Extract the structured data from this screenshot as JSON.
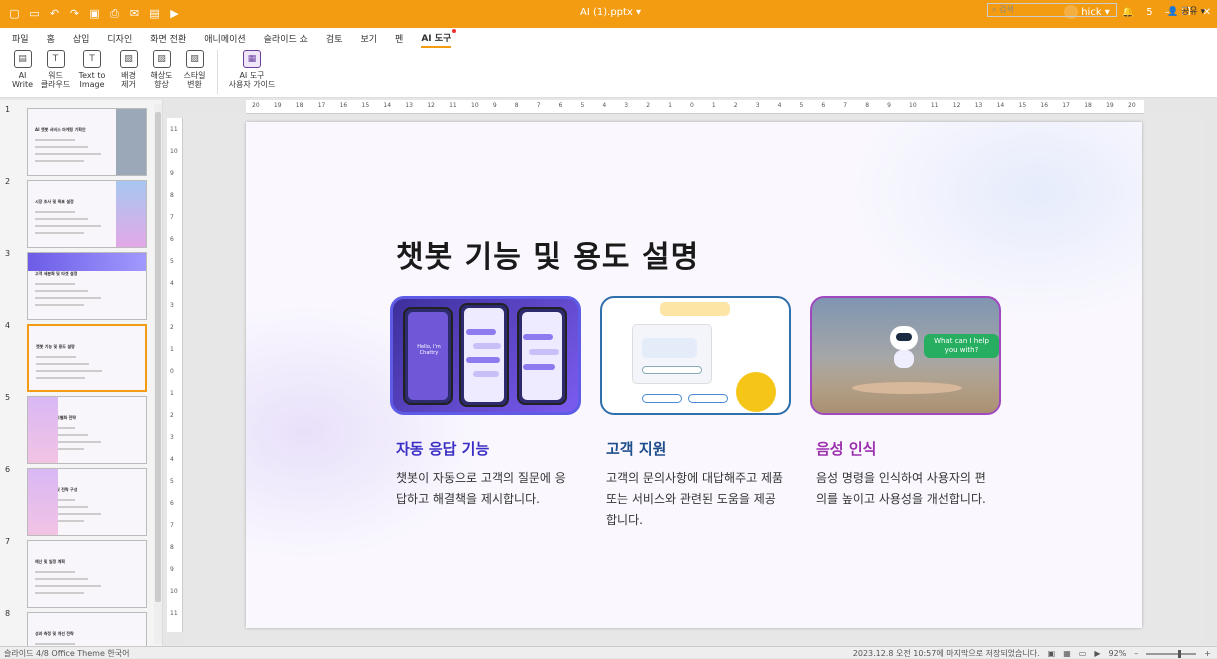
{
  "window": {
    "doc_title": "AI (1).pptx",
    "user": "hick",
    "notif": "5"
  },
  "menu": [
    "파일",
    "홈",
    "삽입",
    "디자인",
    "화면 전환",
    "애니메이션",
    "슬라이드 쇼",
    "검토",
    "보기",
    "펜",
    "AI 도구"
  ],
  "search": {
    "placeholder": "검색"
  },
  "share": "공유",
  "ribbon": [
    {
      "l1": "AI",
      "l2": "Write",
      "icon": "document-icon"
    },
    {
      "l1": "워드",
      "l2": "클라우드",
      "icon": "text-t-icon"
    },
    {
      "l1": "Text to",
      "l2": "Image",
      "icon": "text-image-icon"
    },
    {
      "l1": "배경",
      "l2": "제거",
      "icon": "bg-remove-icon"
    },
    {
      "l1": "해상도",
      "l2": "향상",
      "icon": "upscale-icon"
    },
    {
      "l1": "스타일",
      "l2": "변환",
      "icon": "style-icon"
    },
    {
      "l1": "AI 도구",
      "l2": "사용자 가이드",
      "icon": "guide-icon"
    }
  ],
  "thumbs": [
    {
      "n": "1",
      "title": "AI 챗봇 서비스 마케팅 기획안"
    },
    {
      "n": "2",
      "title": "시장 조사 및 목표 설정"
    },
    {
      "n": "3",
      "title": "고객 세분화 및 타겟 설정"
    },
    {
      "n": "4",
      "title": "챗봇 기능 및 용도 설명"
    },
    {
      "n": "5",
      "title": "경쟁 분석과 차별화 전략"
    },
    {
      "n": "6",
      "title": "마케팅 채널 및 전략 구성"
    },
    {
      "n": "7",
      "title": "예산 및 일정 계획"
    },
    {
      "n": "8",
      "title": "성과 측정 및 개선 전략"
    }
  ],
  "hruler": [
    "20",
    "19",
    "18",
    "17",
    "16",
    "15",
    "14",
    "13",
    "12",
    "11",
    "10",
    "9",
    "8",
    "7",
    "6",
    "5",
    "4",
    "3",
    "2",
    "1",
    "0",
    "1",
    "2",
    "3",
    "4",
    "5",
    "6",
    "7",
    "8",
    "9",
    "10",
    "11",
    "12",
    "13",
    "14",
    "15",
    "16",
    "17",
    "18",
    "19",
    "20"
  ],
  "vruler": [
    "11",
    "10",
    "9",
    "8",
    "7",
    "6",
    "5",
    "4",
    "3",
    "2",
    "1",
    "0",
    "1",
    "2",
    "3",
    "4",
    "5",
    "6",
    "7",
    "8",
    "9",
    "10",
    "11"
  ],
  "slide": {
    "title": "챗봇 기능 및 용도 설명",
    "cards": [
      {
        "head": "자동 응답 기능",
        "color": "#3a2fc4",
        "body": "챗봇이 자동으로 고객의 질문에 응답하고 해결책을 제시합니다."
      },
      {
        "head": "고객 지원",
        "color": "#1f4e8c",
        "body": "고객의 문의사항에 대답해주고 제품 또는 서비스와 관련된 도움을 제공합니다."
      },
      {
        "head": "음성 인식",
        "color": "#9b2fae",
        "body": "음성 명령을 인식하여 사용자의 편의를 높이고 사용성을 개선합니다."
      }
    ],
    "robot_msg": "What can I help you with?",
    "phone_text": "Hello, I'm Chattry"
  },
  "status": {
    "left": "슬라이드 4/8   Office Theme   한국어",
    "saved": "2023.12.8 오전 10:57에 마지막으로 저장되었습니다.",
    "zoom": "92%"
  }
}
